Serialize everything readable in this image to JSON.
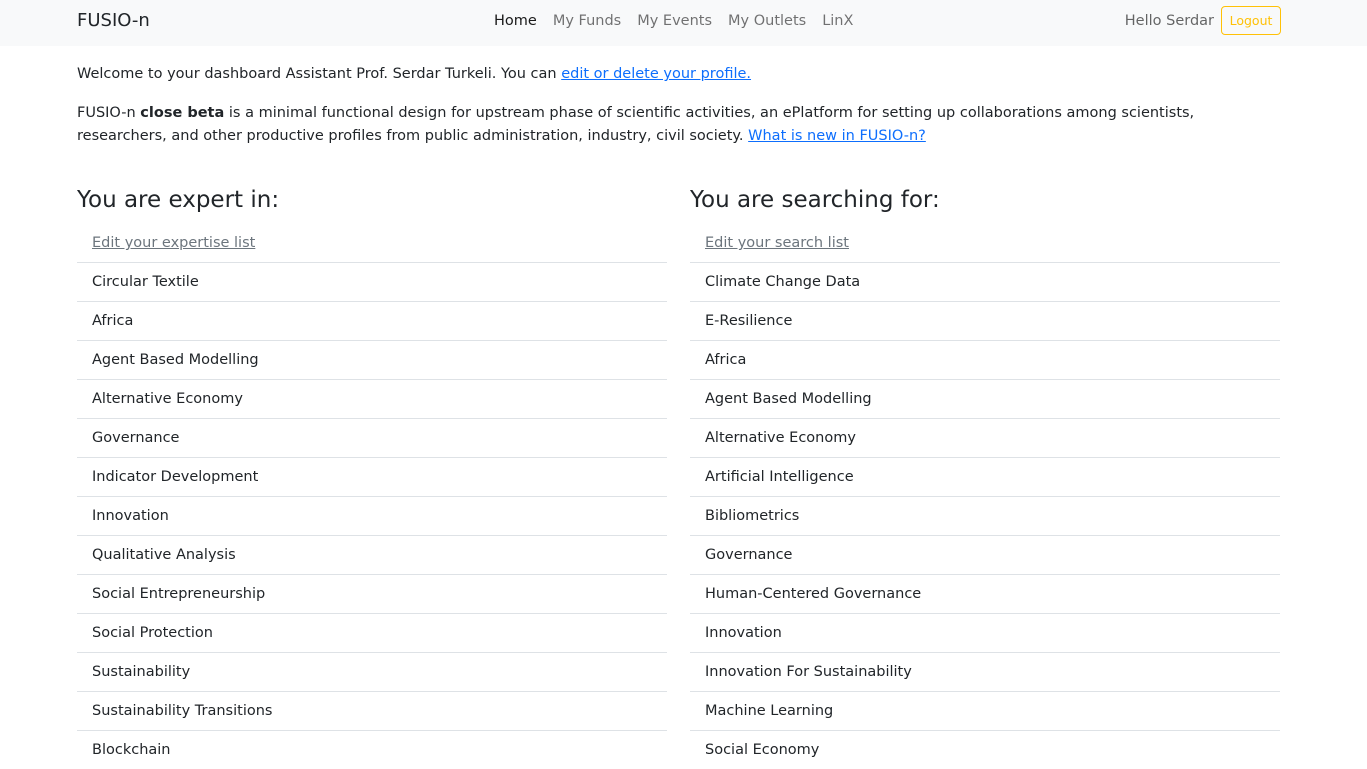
{
  "navbar": {
    "brand": "FUSIO-n",
    "links": [
      "Home",
      "My Funds",
      "My Events",
      "My Outlets",
      "LinX"
    ],
    "hello": "Hello Serdar",
    "logout": "Logout"
  },
  "welcome": {
    "text": "Welcome to your dashboard Assistant Prof. Serdar Turkeli. You can ",
    "link": "edit or delete your profile."
  },
  "intro": {
    "prefix": "FUSIO-n ",
    "bold": "close beta",
    "text": " is a minimal functional design for upstream phase of scientific activities, an ePlatform for setting up collaborations among scientists, researchers, and other productive profiles from public administration, industry, civil society. ",
    "link": "What is new in FUSIO-n?"
  },
  "expertise": {
    "heading": "You are expert in:",
    "edit_link": "Edit your expertise list",
    "items": [
      "Circular Textile",
      "Africa",
      "Agent Based Modelling",
      "Alternative Economy",
      "Governance",
      "Indicator Development",
      "Innovation",
      "Qualitative Analysis",
      "Social Entrepreneurship",
      "Social Protection",
      "Sustainability",
      "Sustainability Transitions",
      "Blockchain"
    ]
  },
  "searching": {
    "heading": "You are searching for:",
    "edit_link": "Edit your search list",
    "items": [
      "Climate Change Data",
      "E-Resilience",
      "Africa",
      "Agent Based Modelling",
      "Alternative Economy",
      "Artificial Intelligence",
      "Bibliometrics",
      "Governance",
      "Human-Centered Governance",
      "Innovation",
      "Innovation For Sustainability",
      "Machine Learning",
      "Social Economy"
    ]
  },
  "colors": {
    "navbar_bg": "#f8f9fa",
    "link": "#0d6efd",
    "logout_accent": "#ffc107",
    "muted": "#6c757d"
  }
}
